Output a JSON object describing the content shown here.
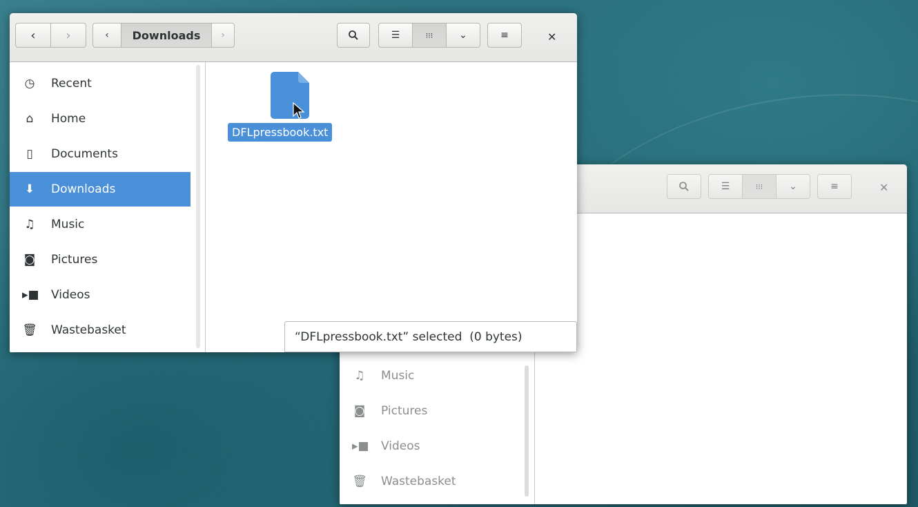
{
  "front_window": {
    "location": "Downloads",
    "sidebar": [
      {
        "label": "Recent",
        "icon": "clock-icon"
      },
      {
        "label": "Home",
        "icon": "home-icon"
      },
      {
        "label": "Documents",
        "icon": "document-icon"
      },
      {
        "label": "Downloads",
        "icon": "download-icon",
        "active": true
      },
      {
        "label": "Music",
        "icon": "music-icon"
      },
      {
        "label": "Pictures",
        "icon": "camera-icon"
      },
      {
        "label": "Videos",
        "icon": "video-icon"
      },
      {
        "label": "Wastebasket",
        "icon": "trash-icon"
      }
    ],
    "file": {
      "name": "DFLpressbook.txt",
      "icon": "text-file-icon"
    },
    "status": "“DFLpressbook.txt” selected  (0 bytes)"
  },
  "back_window": {
    "sidebar": [
      {
        "label": "Music",
        "icon": "music-icon"
      },
      {
        "label": "Pictures",
        "icon": "camera-icon"
      },
      {
        "label": "Videos",
        "icon": "video-icon"
      },
      {
        "label": "Wastebasket",
        "icon": "trash-icon"
      }
    ]
  },
  "colors": {
    "accent": "#4a90d9",
    "desktop": "#276978"
  }
}
